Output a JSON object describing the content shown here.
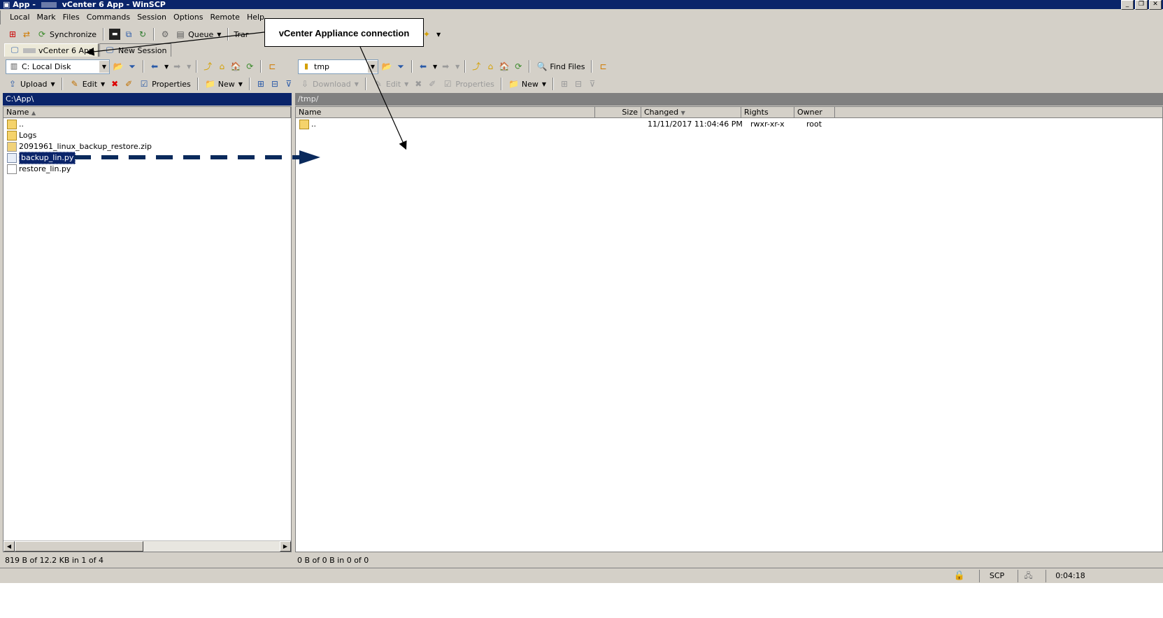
{
  "window": {
    "title_prefix": "App -",
    "title_suffix": "vCenter 6 App - WinSCP",
    "buttons": [
      "_",
      "❐",
      "✕"
    ]
  },
  "menu": [
    "Local",
    "Mark",
    "Files",
    "Commands",
    "Session",
    "Options",
    "Remote",
    "Help"
  ],
  "toolbar": {
    "synchronize": "Synchronize",
    "queue": "Queue",
    "transfer": "Trar"
  },
  "tabs": [
    {
      "label": "vCenter 6 App"
    },
    {
      "label": "New Session"
    }
  ],
  "local": {
    "drive": "C: Local Disk",
    "path": "C:\\App\\",
    "actions": {
      "upload": "Upload",
      "edit": "Edit",
      "properties": "Properties",
      "new": "New"
    },
    "columns": [
      "Name"
    ],
    "files": [
      {
        "name": "..",
        "type": "up"
      },
      {
        "name": "Logs",
        "type": "folder"
      },
      {
        "name": "2091961_linux_backup_restore.zip",
        "type": "zip"
      },
      {
        "name": "backup_lin.py",
        "type": "py",
        "selected": true
      },
      {
        "name": "restore_lin.py",
        "type": "py"
      }
    ],
    "status": "819 B of 12.2 KB in 1 of 4"
  },
  "remote": {
    "dir": "tmp",
    "path": "/tmp/",
    "find_files": "Find Files",
    "actions": {
      "download": "Download",
      "edit": "Edit",
      "properties": "Properties",
      "new": "New"
    },
    "columns": [
      "Name",
      "Size",
      "Changed",
      "Rights",
      "Owner"
    ],
    "files": [
      {
        "name": "..",
        "size": "",
        "changed": "11/11/2017 11:04:46 PM",
        "rights": "rwxr-xr-x",
        "owner": "root"
      }
    ],
    "status": "0 B of 0 B in 0 of 0"
  },
  "statusbar": {
    "protocol": "SCP",
    "time": "0:04:18"
  },
  "annotation": {
    "callout": "vCenter Appliance connection"
  },
  "colors": {
    "titlebar": "#0a246a",
    "selection": "#0a246a",
    "arrow": "#0a2a5c",
    "remote_path_bg": "#808080"
  }
}
